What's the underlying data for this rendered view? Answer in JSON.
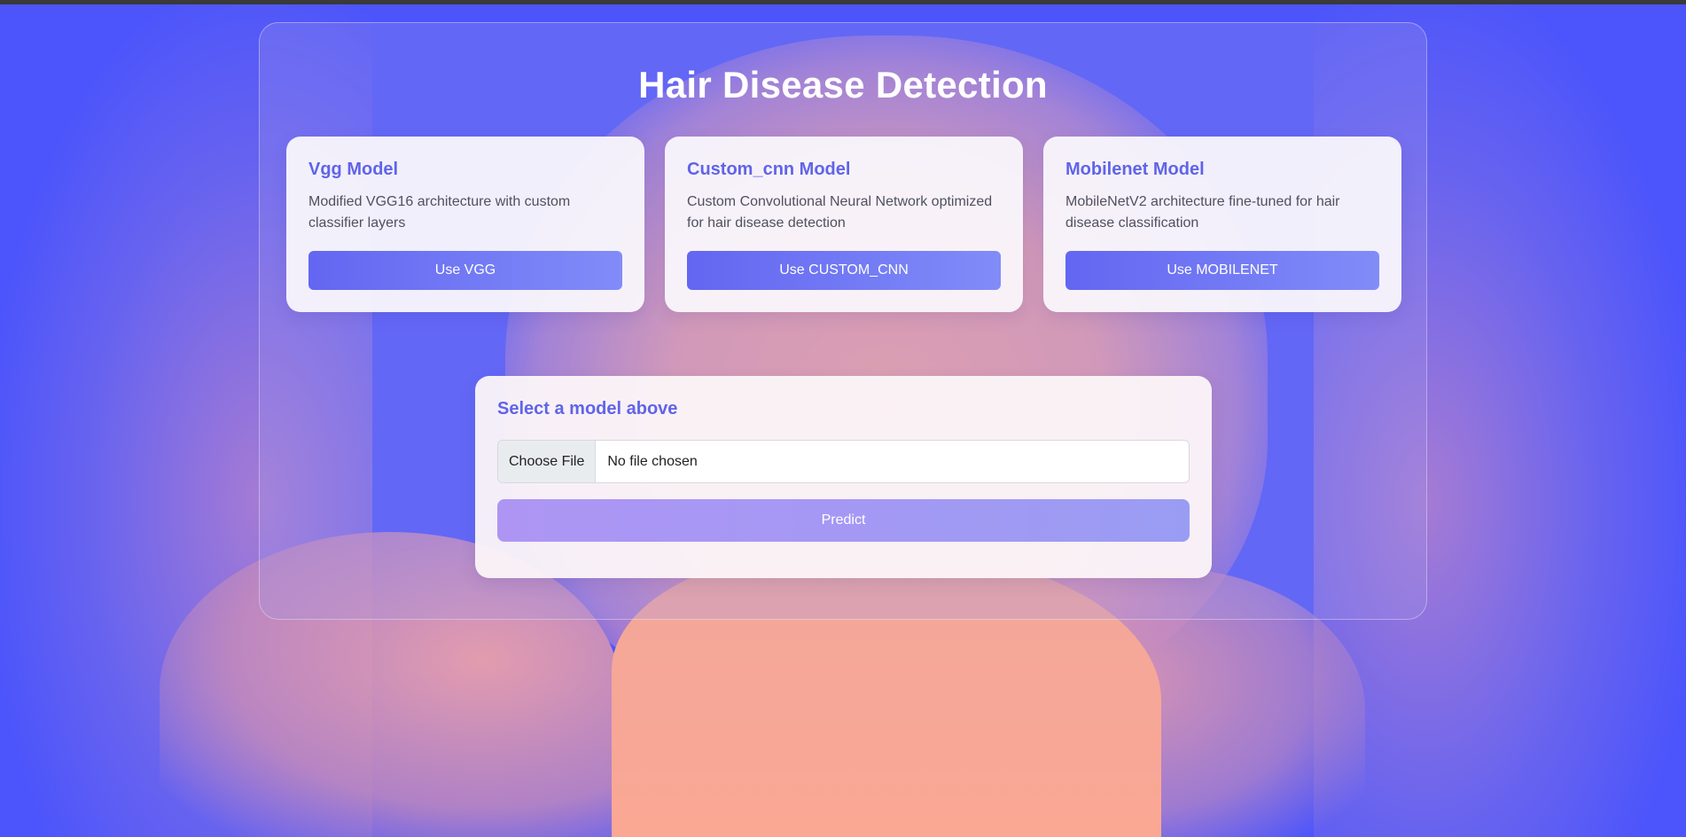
{
  "page": {
    "title": "Hair Disease Detection"
  },
  "models": [
    {
      "title": "Vgg Model",
      "description": "Modified VGG16 architecture with custom classifier layers",
      "button_label": "Use VGG"
    },
    {
      "title": "Custom_cnn Model",
      "description": "Custom Convolutional Neural Network optimized for hair disease detection",
      "button_label": "Use CUSTOM_CNN"
    },
    {
      "title": "Mobilenet Model",
      "description": "MobileNetV2 architecture fine-tuned for hair disease classification",
      "button_label": "Use MOBILENET"
    }
  ],
  "upload": {
    "heading": "Select a model above",
    "choose_file_label": "Choose File",
    "file_status": "No file chosen",
    "predict_label": "Predict"
  },
  "colors": {
    "accent": "#6366f1",
    "background": "#4c55fb",
    "predict_gradient_start": "#ae95f4",
    "predict_gradient_end": "#9a9cf3"
  }
}
